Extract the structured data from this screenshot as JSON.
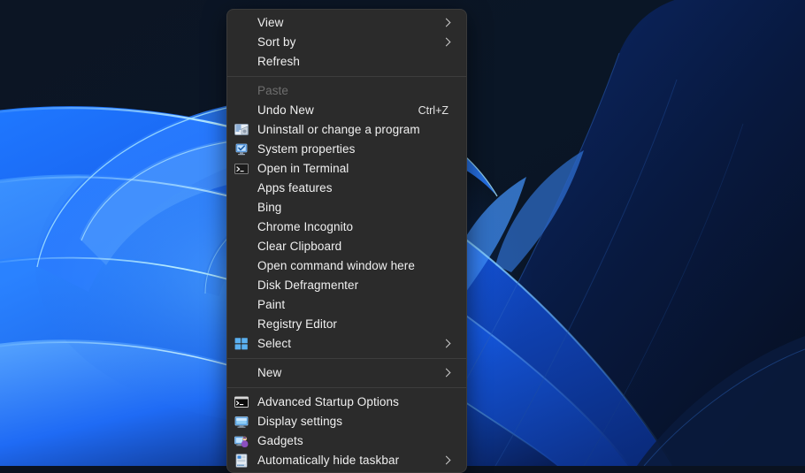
{
  "desktop": {
    "wallpaper_name": "windows-bloom-wallpaper",
    "colors": {
      "bg_dark": "#081018",
      "bloom_blue": "#1560f0",
      "bloom_light": "#4aa8ff",
      "bloom_cyan": "#7fd4ff",
      "bloom_deep": "#0b1f4a"
    }
  },
  "context_menu": {
    "name": "desktop-context-menu",
    "background": "#2b2b2b",
    "border": "#3a3a3a",
    "text_color": "#f0f0f0",
    "disabled_color": "#6e6e6e",
    "separator_color": "#3d3d3d",
    "groups": [
      {
        "items": [
          {
            "label": "View",
            "icon": "none",
            "submenu": true,
            "accel": "",
            "disabled": false
          },
          {
            "label": "Sort by",
            "icon": "none",
            "submenu": true,
            "accel": "",
            "disabled": false
          },
          {
            "label": "Refresh",
            "icon": "none",
            "submenu": false,
            "accel": "",
            "disabled": false
          }
        ]
      },
      {
        "items": [
          {
            "label": "Paste",
            "icon": "none",
            "submenu": false,
            "accel": "",
            "disabled": true
          },
          {
            "label": "Undo New",
            "icon": "none",
            "submenu": false,
            "accel": "Ctrl+Z",
            "disabled": false
          },
          {
            "label": "Uninstall or change a program",
            "icon": "programs-and-features-icon",
            "submenu": false,
            "accel": "",
            "disabled": false
          },
          {
            "label": "System properties",
            "icon": "system-properties-icon",
            "submenu": false,
            "accel": "",
            "disabled": false
          },
          {
            "label": "Open in Terminal",
            "icon": "terminal-icon",
            "submenu": false,
            "accel": "",
            "disabled": false
          },
          {
            "label": "Apps  features",
            "icon": "none",
            "submenu": false,
            "accel": "",
            "disabled": false
          },
          {
            "label": "Bing",
            "icon": "none",
            "submenu": false,
            "accel": "",
            "disabled": false
          },
          {
            "label": "Chrome Incognito",
            "icon": "none",
            "submenu": false,
            "accel": "",
            "disabled": false
          },
          {
            "label": "Clear Clipboard",
            "icon": "none",
            "submenu": false,
            "accel": "",
            "disabled": false
          },
          {
            "label": "Open command window here",
            "icon": "none",
            "submenu": false,
            "accel": "",
            "disabled": false
          },
          {
            "label": "Disk Defragmenter",
            "icon": "none",
            "submenu": false,
            "accel": "",
            "disabled": false
          },
          {
            "label": "Paint",
            "icon": "none",
            "submenu": false,
            "accel": "",
            "disabled": false
          },
          {
            "label": "Registry Editor",
            "icon": "none",
            "submenu": false,
            "accel": "",
            "disabled": false
          },
          {
            "label": "Select",
            "icon": "select-grid-icon",
            "submenu": true,
            "accel": "",
            "disabled": false
          }
        ]
      },
      {
        "items": [
          {
            "label": "New",
            "icon": "none",
            "submenu": true,
            "accel": "",
            "disabled": false
          }
        ]
      },
      {
        "items": [
          {
            "label": "Advanced Startup Options",
            "icon": "command-prompt-icon",
            "submenu": false,
            "accel": "",
            "disabled": false
          },
          {
            "label": "Display settings",
            "icon": "display-settings-icon",
            "submenu": false,
            "accel": "",
            "disabled": false
          },
          {
            "label": "Gadgets",
            "icon": "gadgets-icon",
            "submenu": false,
            "accel": "",
            "disabled": false
          },
          {
            "label": "Automatically hide taskbar",
            "icon": "taskbar-icon",
            "submenu": true,
            "accel": "",
            "disabled": false
          }
        ]
      }
    ]
  }
}
